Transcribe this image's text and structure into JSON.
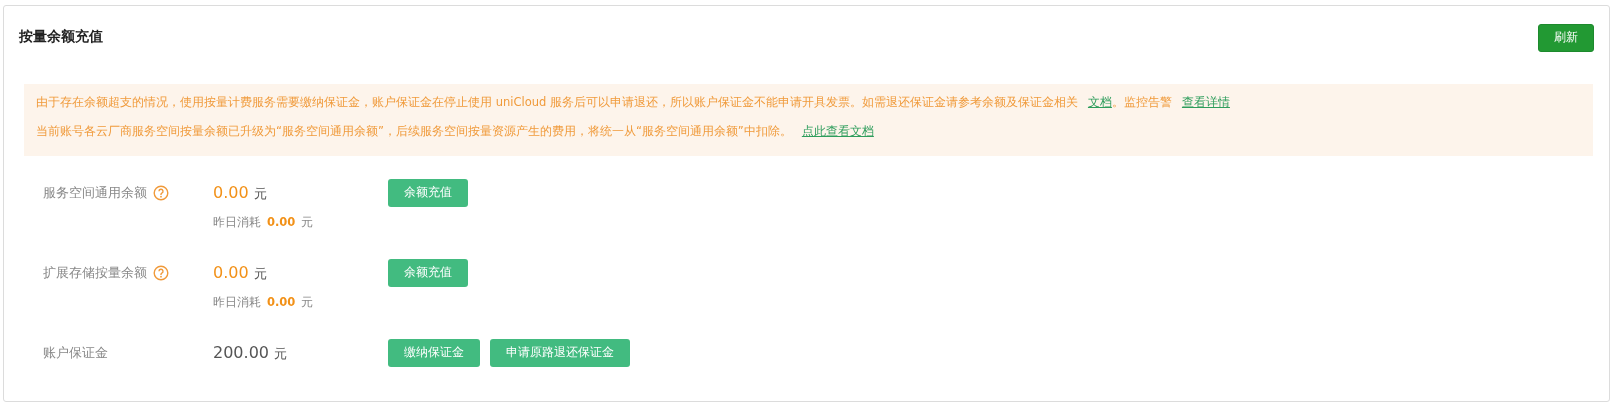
{
  "title": "按量余额充值",
  "refresh_button": "刷新",
  "notice": [
    {
      "segments": [
        {
          "kind": "text",
          "text": "由于存在余额超支的情况，使用按量计费服务需要缴纳保证金，账户保证金在停止使用 uniCloud 服务后可以申请退还，所以账户保证金不能申请开具发票。如需退还保证金请参考余额及保证金相关"
        },
        {
          "kind": "link",
          "text": "文档"
        },
        {
          "kind": "text",
          "text": "。监控告警"
        },
        {
          "kind": "link",
          "text": "查看详情"
        }
      ]
    },
    {
      "segments": [
        {
          "kind": "text",
          "text": "当前账号各云厂商服务空间按量余额已升级为“服务空间通用余额”，后续服务空间按量资源产生的费用，将统一从“服务空间通用余额”中扣除。"
        },
        {
          "kind": "link",
          "text": "点此查看文档"
        }
      ]
    }
  ],
  "rows": [
    {
      "label": "服务空间通用余额",
      "help": true,
      "amount": "0.00",
      "unit": "元",
      "highlight": true,
      "buttons": [
        "余额充值"
      ],
      "yesterday": {
        "label": "昨日消耗",
        "amount": "0.00",
        "unit": "元"
      }
    },
    {
      "label": "扩展存储按量余额",
      "help": true,
      "amount": "0.00",
      "unit": "元",
      "highlight": true,
      "buttons": [
        "余额充值"
      ],
      "yesterday": {
        "label": "昨日消耗",
        "amount": "0.00",
        "unit": "元"
      }
    },
    {
      "label": "账户保证金",
      "help": false,
      "amount": "200.00",
      "unit": "元",
      "highlight": false,
      "buttons": [
        "缴纳保证金",
        "申请原路退还保证金"
      ]
    }
  ]
}
